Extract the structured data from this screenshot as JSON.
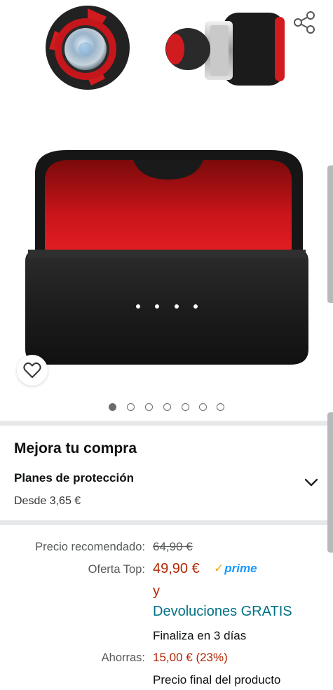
{
  "gallery": {
    "image_count": 7,
    "active_index": 0,
    "share_icon": "share-icon",
    "wishlist_icon": "heart-icon"
  },
  "upgrade": {
    "title": "Mejora tu compra",
    "plans_title": "Planes de protección",
    "plans_price": "Desde 3,65 €"
  },
  "pricing": {
    "list_label": "Precio recomendado:",
    "list_price": "64,90 €",
    "deal_label": "Oferta Top:",
    "deal_price": "49,90 €",
    "prime_check": "✓",
    "prime_text": "prime",
    "conjunction": "y",
    "returns": "Devoluciones GRATIS",
    "ends": "Finaliza en 3 días",
    "savings_label": "Ahorras:",
    "savings": "15,00 € (23%)",
    "final_note": "Precio final del producto"
  },
  "colors": {
    "deal_red": "#b12704",
    "link_teal": "#007185",
    "prime_blue": "#1a98ff",
    "divider": "#e6e8e9"
  }
}
